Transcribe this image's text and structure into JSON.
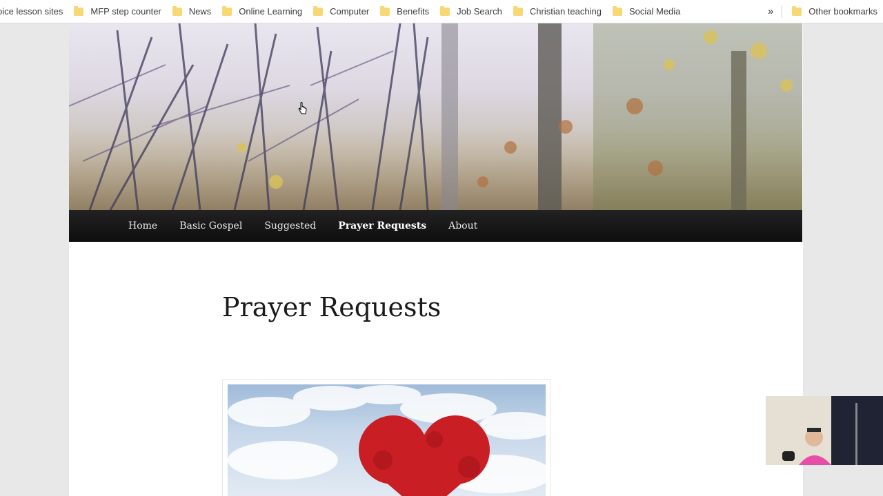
{
  "bookmarks": {
    "items": [
      {
        "label": "oice lesson sites",
        "folder": false
      },
      {
        "label": "MFP step counter",
        "folder": true
      },
      {
        "label": "News",
        "folder": true
      },
      {
        "label": "Online Learning",
        "folder": true
      },
      {
        "label": "Computer",
        "folder": true
      },
      {
        "label": "Benefits",
        "folder": true
      },
      {
        "label": "Job Search",
        "folder": true
      },
      {
        "label": "Christian teaching",
        "folder": true
      },
      {
        "label": "Social Media",
        "folder": true
      }
    ],
    "overflow_label": "»",
    "other": "Other bookmarks"
  },
  "nav": {
    "items": [
      "Home",
      "Basic Gospel",
      "Suggested",
      "Prayer Requests",
      "About"
    ],
    "current": "Prayer Requests"
  },
  "page": {
    "title": "Prayer Requests"
  },
  "colors": {
    "nav_bg": "#111111",
    "folder": "#f8d775",
    "heart": "#c81e24"
  }
}
